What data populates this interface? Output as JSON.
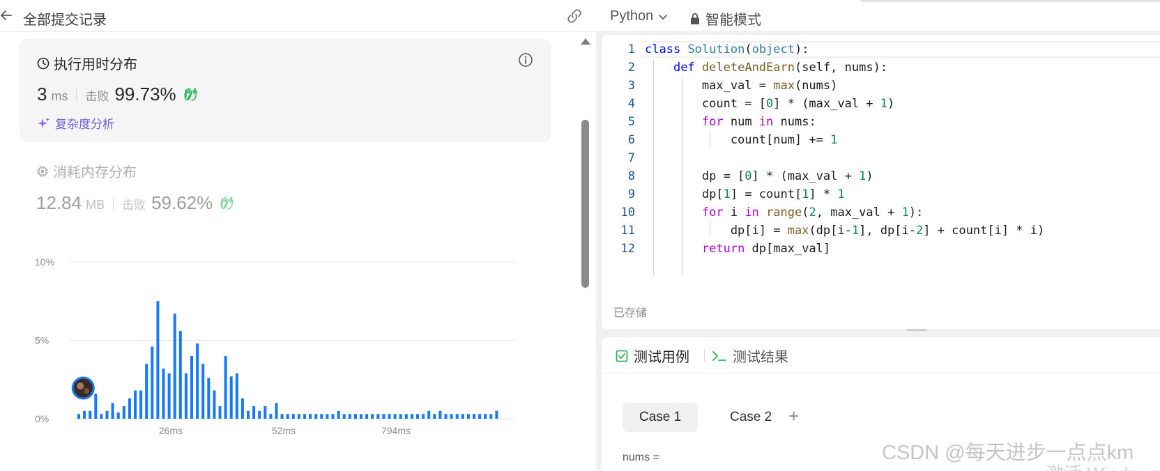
{
  "left_header": {
    "title": "全部提交记录"
  },
  "runtime": {
    "title": "执行用时分布",
    "value": "3",
    "unit": "ms",
    "beat_label": "击败",
    "beat_pct": "99.73%",
    "complexity_link": "复杂度分析"
  },
  "memory": {
    "title": "消耗内存分布",
    "value": "12.84",
    "unit": "MB",
    "beat_label": "击败",
    "beat_pct": "59.62%"
  },
  "chart_data": {
    "type": "bar",
    "title": "",
    "xlabel": "",
    "ylabel": "",
    "y_tick_labels": [
      "10%",
      "5%",
      "0%"
    ],
    "x_tick_labels": [
      "26ms",
      "52ms",
      "794ms"
    ],
    "ylim": [
      0,
      10
    ],
    "grid": true,
    "values": [
      0.3,
      0.5,
      0.5,
      1.6,
      0.3,
      0.5,
      1.0,
      0.4,
      0.8,
      1.3,
      1.8,
      1.8,
      3.5,
      4.6,
      7.5,
      3.2,
      2.9,
      6.7,
      5.6,
      2.9,
      4.0,
      4.8,
      3.5,
      2.6,
      1.8,
      0.8,
      4.0,
      2.7,
      2.9,
      1.3,
      0.5,
      0.8,
      0.5,
      0.8,
      0.3,
      1.0,
      0.3,
      0.3,
      0.3,
      0.3,
      0.3,
      0.3,
      0.3,
      0.3,
      0.3,
      0.3,
      0.5,
      0.3,
      0.3,
      0.3,
      0.3,
      0.3,
      0.3,
      0.3,
      0.3,
      0.3,
      0.3,
      0.3,
      0.3,
      0.3,
      0.3,
      0.3,
      0.5,
      0.3,
      0.5,
      0.3,
      0.3,
      0.3,
      0.3,
      0.3,
      0.3,
      0.3,
      0.3,
      0.3,
      0.5
    ],
    "bar_color": "#1677ff",
    "marker_index": 3
  },
  "right_header": {
    "language": "Python",
    "mode": "智能模式"
  },
  "editor": {
    "lines": [
      {
        "n": "1",
        "html": "<span class=\"k\">class</span> <span class=\"c\">Solution</span>(<span class=\"c\">object</span>):"
      },
      {
        "n": "2",
        "html": "    <span class=\"k\">def</span> <span class=\"f\">deleteAndEarn</span>(self, nums):"
      },
      {
        "n": "3",
        "html": "        max_val = <span class=\"f\">max</span>(nums)"
      },
      {
        "n": "4",
        "html": "        count = [<span class=\"n\">0</span>] * (max_val + <span class=\"n\">1</span>)"
      },
      {
        "n": "5",
        "html": "        <span class=\"kc\">for</span> num <span class=\"kc\">in</span> nums:"
      },
      {
        "n": "6",
        "html": "            count[num] += <span class=\"n\">1</span>"
      },
      {
        "n": "7",
        "html": ""
      },
      {
        "n": "8",
        "html": "        dp = [<span class=\"n\">0</span>] * (max_val + <span class=\"n\">1</span>)"
      },
      {
        "n": "9",
        "html": "        dp[<span class=\"n\">1</span>] = count[<span class=\"n\">1</span>] * <span class=\"n\">1</span>"
      },
      {
        "n": "10",
        "html": "        <span class=\"kc\">for</span> i <span class=\"kc\">in</span> <span class=\"f\">range</span>(<span class=\"n\">2</span>, max_val + <span class=\"n\">1</span>):"
      },
      {
        "n": "11",
        "html": "            dp[i] = <span class=\"f\">max</span>(dp[i-<span class=\"n\">1</span>], dp[i-<span class=\"n\">2</span>] + count[i] * i)"
      },
      {
        "n": "12",
        "html": "        <span class=\"kc\">return</span> dp[max_val]"
      }
    ],
    "status": "已存储"
  },
  "test_panel": {
    "tab_cases": "测试用例",
    "tab_results": "测试结果",
    "case_1": "Case 1",
    "case_2": "Case 2",
    "add_symbol": "+",
    "nums_label": "nums ="
  },
  "watermark": "CSDN @每天进步一点点km",
  "watermark2": "激活 Windows",
  "icons": {
    "back": "arrow-left-icon",
    "link": "link-icon",
    "clock": "clock-icon",
    "info": "info-icon",
    "hands": "clap-icon",
    "sparkle": "sparkle-icon",
    "chip": "chip-icon",
    "chevron": "chevron-down-icon",
    "lock": "lock-icon",
    "checkbox": "checkbox-icon",
    "terminal": "terminal-icon"
  },
  "colors": {
    "accent": "#1677ff",
    "success": "#2db55d",
    "link": "#6b5fdc"
  }
}
